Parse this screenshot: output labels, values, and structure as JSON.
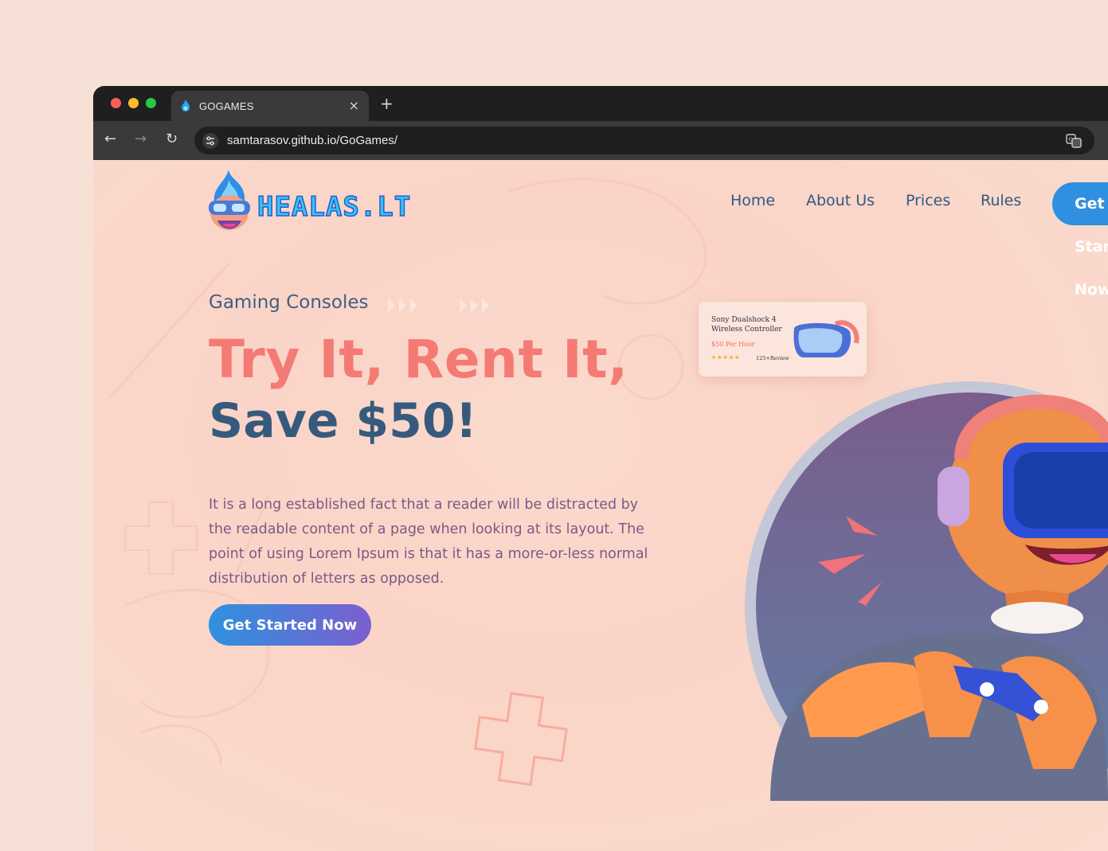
{
  "browser": {
    "tab_title": "GOGAMES",
    "tab_close": "×",
    "new_tab": "+",
    "url": "samtarasov.github.io/GoGames/",
    "back": "←",
    "forward": "→",
    "reload": "↻"
  },
  "site": {
    "logo_text": "HEALAS.LT",
    "nav": {
      "home": "Home",
      "about": "About Us",
      "prices": "Prices",
      "rules": "Rules",
      "cta": "Get Started Now"
    },
    "hero": {
      "eyebrow": "Gaming Consoles",
      "headline_line1": "Try It, Rent It,",
      "headline_line2": "Save $50!",
      "description": "It is a long established fact that a reader will be distracted by the readable content of a page when looking at its layout. The point of using Lorem Ipsum is that it has a more-or-less normal distribution of letters as opposed.",
      "cta": "Get Started Now"
    },
    "product_card": {
      "name": "Sony Dualshock 4 Wireless Controller",
      "price": "$50 Per Hour",
      "rating_stars": "★★★★★",
      "reviews": "125+Review"
    }
  },
  "colors": {
    "accent_coral": "#f47b74",
    "navy": "#365a7d",
    "button_blue": "#2e91df",
    "button_purple": "#7b5fcf"
  }
}
